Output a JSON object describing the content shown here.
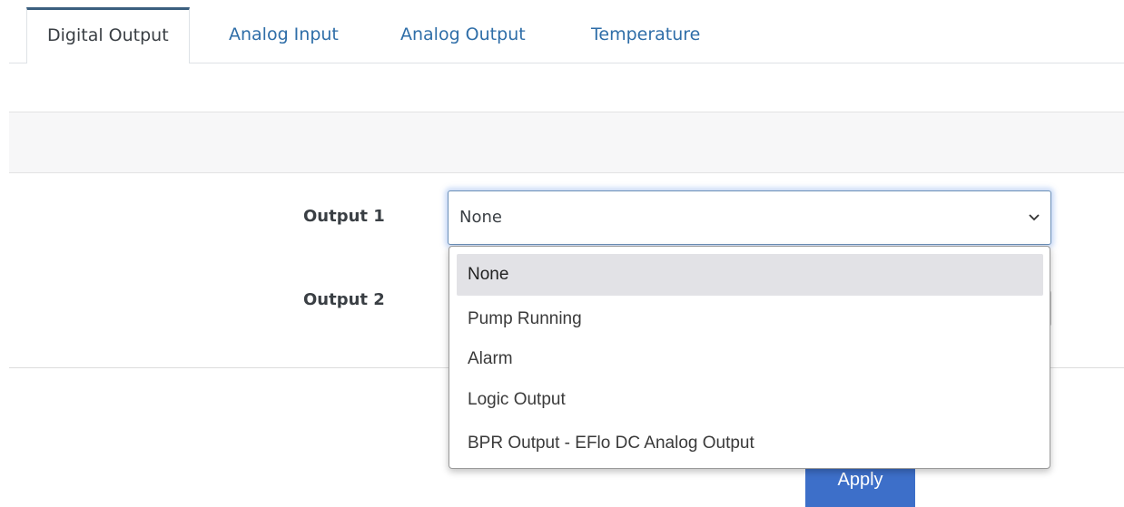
{
  "tabs": [
    {
      "label": "Digital Output",
      "active": true
    },
    {
      "label": "Analog Input",
      "active": false
    },
    {
      "label": "Analog Output",
      "active": false
    },
    {
      "label": "Temperature",
      "active": false
    }
  ],
  "form": {
    "output1_label": "Output 1",
    "output2_label": "Output 2",
    "output1_value": "None"
  },
  "dropdown": {
    "options": [
      "None",
      "Pump Running",
      "Alarm",
      "Logic Output",
      "BPR Output - EFlo DC Analog Output"
    ],
    "selected_index": 0
  },
  "apply_label": "Apply",
  "icons": {
    "select_arrow": "chevron-down-icon"
  },
  "colors": {
    "link": "#2f6ea8",
    "active_tab_border": "#3b5f7f",
    "apply_button": "#3d6fc9",
    "selected_option_bg": "#e2e2e6"
  }
}
